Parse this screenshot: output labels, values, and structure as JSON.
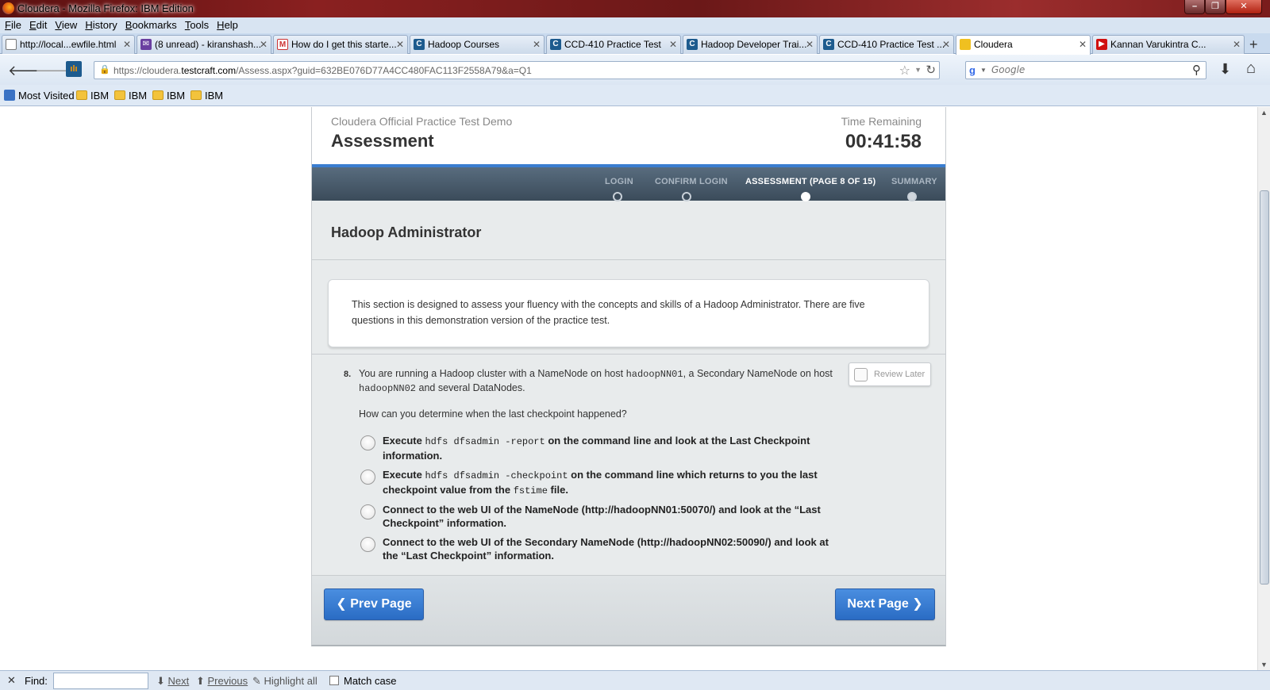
{
  "window": {
    "title": "Cloudera - Mozilla Firefox: IBM Edition",
    "min": "–",
    "max": "❐",
    "close": "✕"
  },
  "menu": [
    "File",
    "Edit",
    "View",
    "History",
    "Bookmarks",
    "Tools",
    "Help"
  ],
  "tabs": [
    {
      "label": "http://local...ewfile.html",
      "icon": "page-icon"
    },
    {
      "label": "(8 unread) - kiranshash...",
      "icon": "yahoo-mail-icon"
    },
    {
      "label": "How do I get this starte...",
      "icon": "gmail-icon"
    },
    {
      "label": "Hadoop Courses",
      "icon": "cloudera-icon"
    },
    {
      "label": "CCD-410 Practice Test",
      "icon": "cloudera-icon"
    },
    {
      "label": "Hadoop Developer Trai...",
      "icon": "cloudera-icon"
    },
    {
      "label": "CCD-410 Practice Test ...",
      "icon": "cloudera-icon"
    },
    {
      "label": "Cloudera",
      "icon": "ibm-icon"
    },
    {
      "label": "Kannan Varukintra C...",
      "icon": "youtube-icon"
    }
  ],
  "navbar": {
    "url_prefix": "https://cloudera.",
    "url_domain": "testcraft.com",
    "url_path": "/Assess.aspx?guid=632BE076D77A4CC480FAC113F2558A79&a=Q1",
    "search_placeholder": "Google"
  },
  "bookmarks": [
    "Most Visited",
    "IBM",
    "IBM",
    "IBM",
    "IBM"
  ],
  "page": {
    "subtitle": "Cloudera Official Practice Test Demo",
    "heading": "Assessment",
    "time_label": "Time Remaining",
    "time_value": "00:41:58",
    "steps": [
      {
        "label": "LOGIN",
        "state": "done"
      },
      {
        "label": "CONFIRM LOGIN",
        "state": "done"
      },
      {
        "label": "ASSESSMENT (PAGE 8 OF 15)",
        "state": "active"
      },
      {
        "label": "SUMMARY",
        "state": "pending"
      }
    ],
    "section_title": "Hadoop Administrator",
    "intro": "This section is designed to assess your fluency with the concepts and skills of a Hadoop Administrator. There are five questions in this demonstration version of the practice test.",
    "question": {
      "number": "8.",
      "text_1": "You are running a Hadoop cluster with a NameNode on host ",
      "host_1": "hadoopNN01",
      "text_2": ", a Secondary NameNode on host ",
      "host_2": "hadoopNN02",
      "text_3": " and several DataNodes.",
      "ask": "How can you determine when the last checkpoint happened?",
      "review_label": "Review Later",
      "options": [
        {
          "pre": "Execute ",
          "code": "hdfs dfsadmin -report",
          "post": " on the command line and look at the Last Checkpoint information.",
          "code2": "",
          "post2": ""
        },
        {
          "pre": "Execute ",
          "code": "hdfs dfsadmin -checkpoint",
          "post": " on the command line which returns to you  the last checkpoint value from the ",
          "code2": "fstime",
          "post2": " file."
        },
        {
          "pre": "Connect to the web UI of the NameNode (http://hadoopNN01:50070/) and look at the “Last Checkpoint” information.",
          "code": "",
          "post": "",
          "code2": "",
          "post2": ""
        },
        {
          "pre": "Connect to the web UI of the Secondary NameNode (http://hadoopNN02:50090/) and look at the “Last Checkpoint” information.",
          "code": "",
          "post": "",
          "code2": "",
          "post2": ""
        }
      ]
    },
    "prev_label": "❮ Prev Page",
    "next_label": "Next Page ❯"
  },
  "findbar": {
    "close": "✕",
    "label": "Find:",
    "next": "Next",
    "previous": "Previous",
    "highlight": "Highlight all",
    "match_case": "Match case"
  },
  "colors": {
    "accent": "#3a7dd0",
    "button": "#2a6cc4",
    "progress_bar": "#3b4b5a"
  }
}
